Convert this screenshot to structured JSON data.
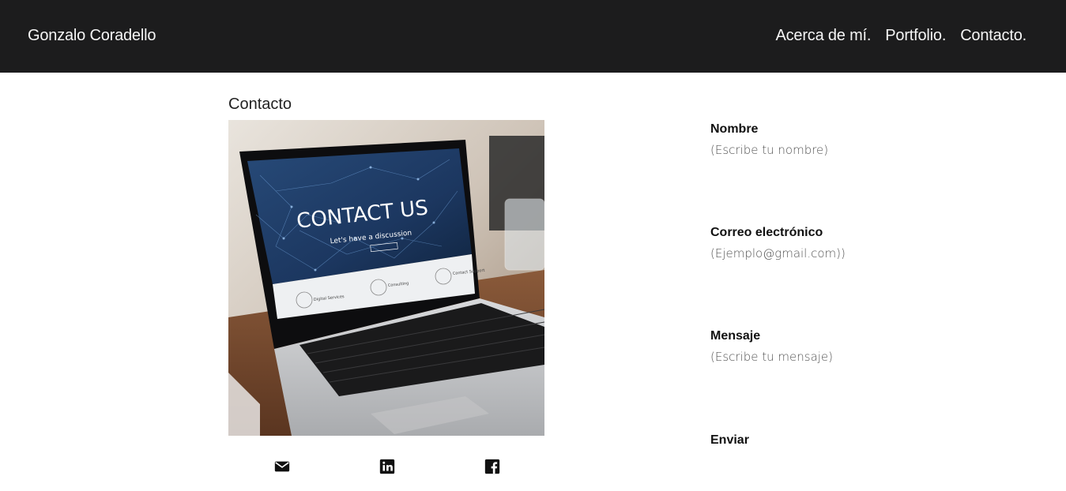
{
  "header": {
    "brand": "Gonzalo Coradello",
    "nav": [
      {
        "label": "Acerca de mí."
      },
      {
        "label": "Portfolio."
      },
      {
        "label": "Contacto."
      }
    ]
  },
  "main": {
    "title": "Contacto",
    "image": {
      "headline": "CONTACT US",
      "subline": "Let's have a discussion",
      "items": [
        "Digital Services",
        "Consulting",
        "Contact Support"
      ]
    },
    "social": [
      {
        "icon": "envelope-icon"
      },
      {
        "icon": "linkedin-icon"
      },
      {
        "icon": "facebook-icon"
      }
    ]
  },
  "form": {
    "name": {
      "label": "Nombre",
      "placeholder": "(Escribe tu nombre)"
    },
    "email": {
      "label": "Correo electrónico",
      "placeholder": "(Ejemplo@gmail.com))"
    },
    "message": {
      "label": "Mensaje",
      "placeholder": "(Escribe tu mensaje)"
    },
    "submit_label": "Enviar"
  },
  "colors": {
    "navbar_bg": "#1c1c1d",
    "nav_text": "#f5f5f5",
    "page_bg": "#ffffff"
  }
}
